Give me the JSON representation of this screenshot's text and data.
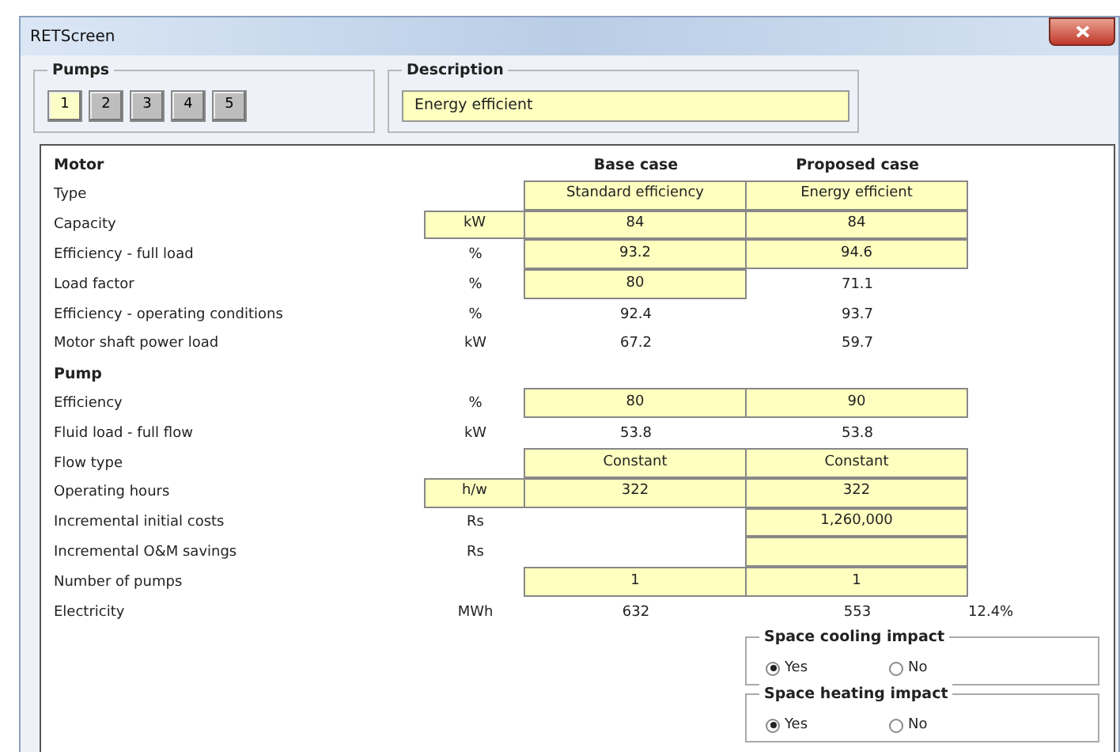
{
  "window": {
    "title": "RETScreen"
  },
  "pumps": {
    "title": "Pumps",
    "buttons": [
      {
        "label": "1",
        "selected": true
      },
      {
        "label": "2",
        "selected": false
      },
      {
        "label": "3",
        "selected": false
      },
      {
        "label": "4",
        "selected": false
      },
      {
        "label": "5",
        "selected": false
      }
    ]
  },
  "description": {
    "title": "Description",
    "value": "Energy efficient"
  },
  "table": {
    "rows": [
      {
        "kind": "header",
        "label": "Motor",
        "base": {
          "value": "Base case"
        },
        "proposed": {
          "value": "Proposed case"
        }
      },
      {
        "kind": "row",
        "label": "Type",
        "base": {
          "value": "Standard efficiency",
          "input": true
        },
        "proposed": {
          "value": "Energy efficient",
          "input": true
        }
      },
      {
        "kind": "row",
        "label": "Capacity",
        "unit": {
          "value": "kW",
          "input": true
        },
        "base": {
          "value": "84",
          "input": true
        },
        "proposed": {
          "value": "84",
          "input": true
        }
      },
      {
        "kind": "row",
        "label": "Efficiency - full load",
        "unit": {
          "value": "%",
          "input": false
        },
        "base": {
          "value": "93.2",
          "input": true
        },
        "proposed": {
          "value": "94.6",
          "input": true
        }
      },
      {
        "kind": "row",
        "label": "Load factor",
        "unit": {
          "value": "%",
          "input": false
        },
        "base": {
          "value": "80",
          "input": true
        },
        "proposed": {
          "value": "71.1",
          "input": false
        }
      },
      {
        "kind": "row",
        "label": "Efficiency - operating conditions",
        "unit": {
          "value": "%",
          "input": false
        },
        "base": {
          "value": "92.4",
          "input": false
        },
        "proposed": {
          "value": "93.7",
          "input": false
        }
      },
      {
        "kind": "row",
        "label": "Motor shaft power load",
        "unit": {
          "value": "kW",
          "input": false
        },
        "base": {
          "value": "67.2",
          "input": false
        },
        "proposed": {
          "value": "59.7",
          "input": false
        }
      },
      {
        "kind": "header",
        "label": "Pump"
      },
      {
        "kind": "row",
        "label": "Efficiency",
        "unit": {
          "value": "%",
          "input": false
        },
        "base": {
          "value": "80",
          "input": true
        },
        "proposed": {
          "value": "90",
          "input": true
        }
      },
      {
        "kind": "row",
        "label": "Fluid load - full flow",
        "unit": {
          "value": "kW",
          "input": false
        },
        "base": {
          "value": "53.8",
          "input": false
        },
        "proposed": {
          "value": "53.8",
          "input": false
        }
      },
      {
        "kind": "row",
        "label": "Flow type",
        "base": {
          "value": "Constant",
          "input": true
        },
        "proposed": {
          "value": "Constant",
          "input": true
        }
      },
      {
        "kind": "row",
        "label": "Operating hours",
        "unit": {
          "value": "h/w",
          "input": true
        },
        "base": {
          "value": "322",
          "input": true
        },
        "proposed": {
          "value": "322",
          "input": true
        }
      },
      {
        "kind": "row",
        "label": "Incremental initial costs",
        "unit": {
          "value": "Rs",
          "input": false
        },
        "proposed": {
          "value": "1,260,000",
          "input": true
        }
      },
      {
        "kind": "row",
        "label": "Incremental O&M savings",
        "unit": {
          "value": "Rs",
          "input": false
        },
        "proposed": {
          "input": true
        }
      },
      {
        "kind": "row",
        "label": "Number of pumps",
        "base": {
          "value": "1",
          "input": true
        },
        "proposed": {
          "value": "1",
          "input": true
        }
      },
      {
        "kind": "row",
        "label": "Electricity",
        "unit": {
          "value": "MWh",
          "input": false
        },
        "base": {
          "value": "632",
          "input": false
        },
        "proposed": {
          "value": "553",
          "input": false
        },
        "extra": "12.4%"
      }
    ]
  },
  "impacts": [
    {
      "title": "Space cooling impact",
      "options": [
        {
          "label": "Yes",
          "selected": true
        },
        {
          "label": "No",
          "selected": false
        }
      ]
    },
    {
      "title": "Space heating impact",
      "options": [
        {
          "label": "Yes",
          "selected": true
        },
        {
          "label": "No",
          "selected": false
        }
      ]
    }
  ]
}
